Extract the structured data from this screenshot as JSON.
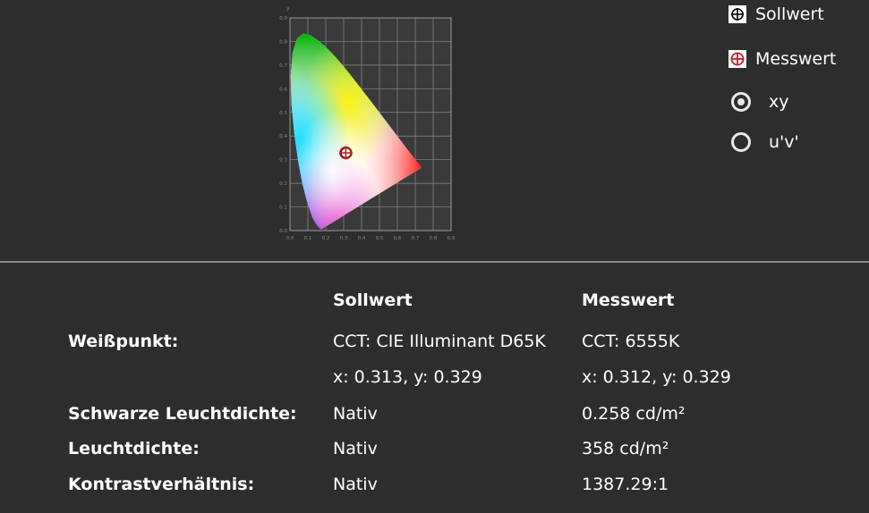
{
  "legend": {
    "target_label": "Sollwert",
    "measured_label": "Messwert",
    "target_icon": "crosshair-box-icon",
    "measured_icon": "crosshair-circle-icon",
    "measured_color": "#c8202a"
  },
  "radios": [
    {
      "label": "xy",
      "checked": true
    },
    {
      "label": "u'v'",
      "checked": false
    }
  ],
  "chart": {
    "x_ticks": [
      "0.0",
      "0.1",
      "0.2",
      "0.3",
      "0.4",
      "0.5",
      "0.6",
      "0.7",
      "0.8",
      "0.9"
    ],
    "y_ticks": [
      "0.9",
      "0.8",
      "0.7",
      "0.6",
      "0.5",
      "0.4",
      "0.3",
      "0.2",
      "0.1",
      "0.0"
    ],
    "y_label": "y"
  },
  "table": {
    "col_target": "Sollwert",
    "col_measured": "Messwert",
    "rows": [
      {
        "label": "Weißpunkt:",
        "target": "CCT: CIE Illuminant D65K",
        "measured": "CCT: 6555K"
      },
      {
        "label": "",
        "target": "x: 0.313, y: 0.329",
        "measured": "x: 0.312, y: 0.329"
      },
      {
        "label": "Schwarze Leuchtdichte:",
        "target": "Nativ",
        "measured": "0.258 cd/m²"
      },
      {
        "label": "Leuchtdichte:",
        "target": "Nativ",
        "measured": "358 cd/m²"
      },
      {
        "label": "Kontrastverhältnis:",
        "target": "Nativ",
        "measured": "1387.29:1"
      }
    ]
  },
  "chart_data": {
    "type": "scatter",
    "xlim": [
      0,
      0.9
    ],
    "ylim": [
      0,
      0.9
    ],
    "grid": true,
    "series": [
      {
        "name": "Sollwert",
        "x": [
          0.313
        ],
        "y": [
          0.329
        ]
      },
      {
        "name": "Messwert",
        "x": [
          0.312
        ],
        "y": [
          0.329
        ]
      }
    ]
  }
}
